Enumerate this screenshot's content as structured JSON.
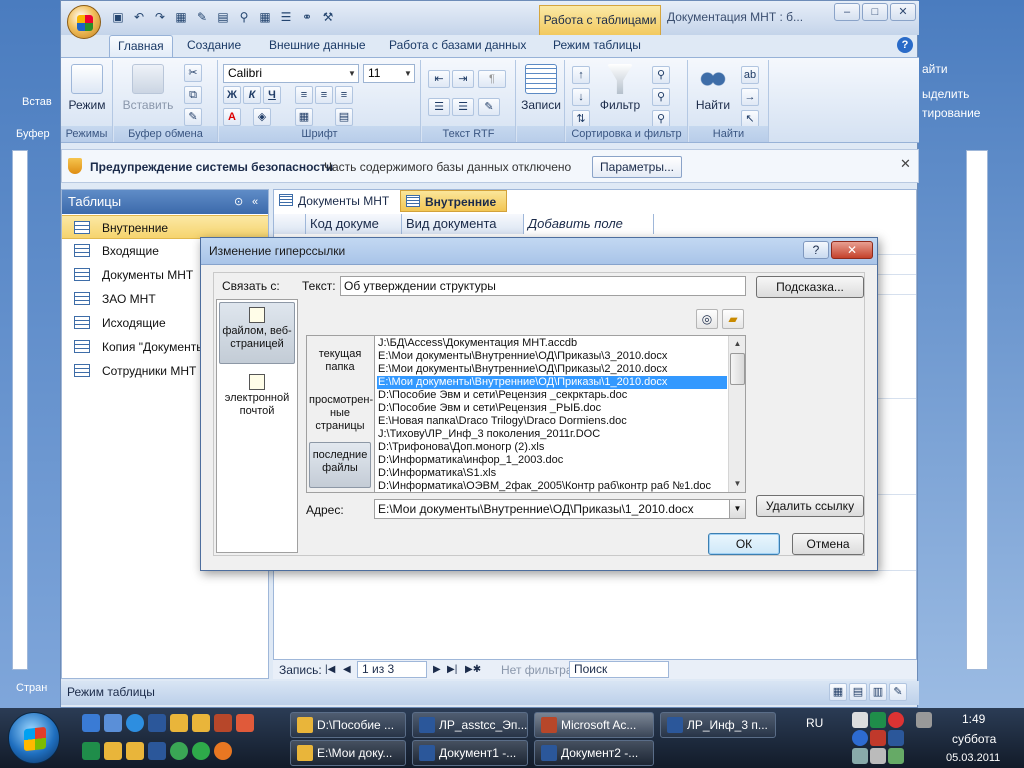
{
  "background_window": {
    "ribbon_right": [
      "айти",
      "ыделить",
      "тирование"
    ],
    "left_items": [
      "Встав",
      "Буфер",
      "Стран"
    ]
  },
  "window": {
    "title": "Документация МНТ : б...",
    "context_tab": "Работа с таблицами",
    "controls": {
      "minimize": "–",
      "maximize": "□",
      "close": "✕"
    },
    "help": "?",
    "tabs": [
      "Главная",
      "Создание",
      "Внешние данные",
      "Работа с базами данных",
      "Режим таблицы"
    ]
  },
  "ribbon": {
    "groups": [
      {
        "label": "Режимы",
        "button": "Режим"
      },
      {
        "label": "Буфер обмена",
        "button": "Вставить"
      },
      {
        "label": "Шрифт",
        "font": "Calibri",
        "size": "11"
      },
      {
        "label": "Текст RTF"
      },
      {
        "label": "",
        "button": "Записи"
      },
      {
        "label": "Сортировка и фильтр",
        "button": "Фильтр"
      },
      {
        "label": "Найти",
        "button": "Найти"
      }
    ],
    "format_buttons": [
      "Ж",
      "К",
      "Ч"
    ]
  },
  "security_bar": {
    "title": "Предупреждение системы безопасности",
    "text": "Часть содержимого базы данных отключено",
    "button": "Параметры...",
    "close": "✕"
  },
  "nav_pane": {
    "header": "Таблицы",
    "items": [
      "Внутренние",
      "Входящие",
      "Документы МНТ",
      "ЗАО МНТ",
      "Исходящие",
      "Копия \"Документы",
      "Сотрудники МНТ"
    ],
    "selected": 0
  },
  "document": {
    "tabs": [
      "Документы МНТ",
      "Внутренние"
    ],
    "active_tab": 1,
    "columns": [
      "Код докуме",
      "Вид документа",
      "Добавить поле"
    ]
  },
  "record_nav": {
    "label": "Запись:",
    "position": "1 из 3",
    "filter": "Нет фильтра",
    "search": "Поиск"
  },
  "status_bar": {
    "text": "Режим таблицы"
  },
  "dialog": {
    "title": "Изменение гиперссылки",
    "help": "?",
    "close": "✕",
    "link_with_label": "Связать с:",
    "text_label": "Текст:",
    "text_value": "Об утверждении структуры",
    "tooltip_button": "Подсказка...",
    "link_options": [
      {
        "label": "файлом, веб-страницей",
        "icon": "web-page-icon",
        "selected": true
      },
      {
        "label": "электронной почтой",
        "icon": "email-icon",
        "selected": false
      }
    ],
    "look_in": [
      {
        "label": "текущая папка",
        "selected": false
      },
      {
        "label": "просмотрен-ные страницы",
        "selected": false
      },
      {
        "label": "последние файлы",
        "selected": true
      }
    ],
    "files": [
      "J:\\БД\\Access\\Документация МНТ.accdb",
      "E:\\Мои документы\\Внутренние\\ОД\\Приказы\\3_2010.docx",
      "E:\\Мои документы\\Внутренние\\ОД\\Приказы\\2_2010.docx",
      "E:\\Мои документы\\Внутренние\\ОД\\Приказы\\1_2010.docx",
      "D:\\Пособие Эвм и сети\\Рецензия _секрктарь.doc",
      "D:\\Пособие Эвм и сети\\Рецензия _РЫБ.doc",
      "E:\\Новая папка\\Draco Trilogy\\Draco Dormiens.doc",
      "J:\\Тихову\\ЛР_Инф_3 поколения_2011г.DOC",
      "D:\\Трифонова\\Доп.моногр (2).xls",
      "D:\\Информатика\\инфор_1_2003.doc",
      "D:\\Информатика\\S1.xls",
      "D:\\Информатика\\ОЭВМ_2фак_2005\\Контр раб\\контр раб №1.doc"
    ],
    "selected_file": 3,
    "address_label": "Адрес:",
    "address_value": "E:\\Мои документы\\Внутренние\\ОД\\Приказы\\1_2010.docx",
    "remove_link": "Удалить ссылку",
    "ok": "ОК",
    "cancel": "Отмена"
  },
  "taskbar": {
    "row1": [
      "D:\\Пособие ...",
      "ЛР_asstcc_Эп...",
      "Microsoft Ac...",
      "ЛР_Инф_3 п..."
    ],
    "row2": [
      "E:\\Мои доку...",
      "Документ1 -...",
      "Документ2 -..."
    ],
    "active": "Microsoft Ac...",
    "lang": "RU",
    "time": "1:49",
    "day": "суббота",
    "date": "05.03.2011"
  }
}
